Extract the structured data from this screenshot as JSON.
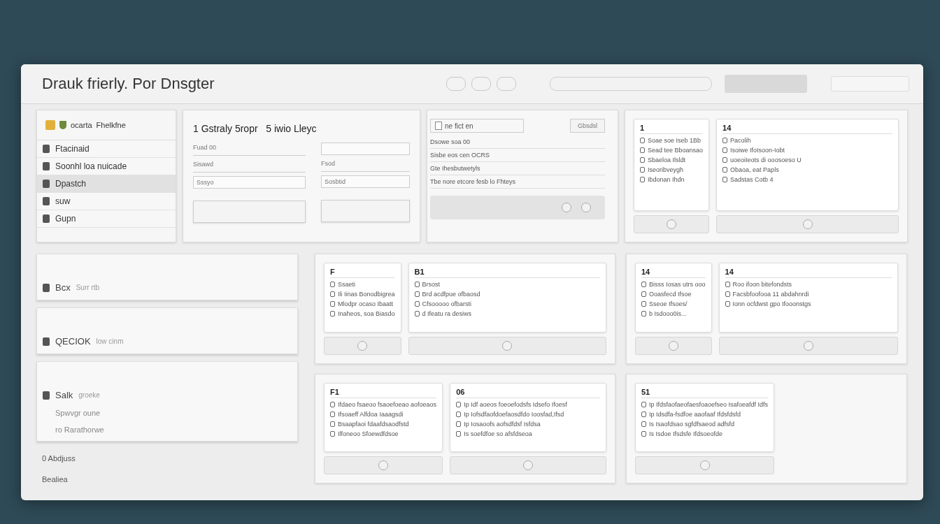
{
  "window": {
    "title": "Drauk frierly. Por Dnsgter"
  },
  "sidebar": {
    "header": [
      "ocarta",
      "Fhelkfne"
    ],
    "items": [
      {
        "label": "Ftacinaid",
        "selected": false
      },
      {
        "label": "Soonhl loa nuicade",
        "selected": false
      },
      {
        "label": "Dpastch",
        "selected": true
      },
      {
        "label": "suw",
        "selected": false
      },
      {
        "label": "Gupn",
        "selected": false
      }
    ]
  },
  "left_cards": [
    {
      "title": "Bcx",
      "subtitle": "Surr rtb"
    },
    {
      "title": "QECIOK",
      "subtitle": "low cinm"
    },
    {
      "title": "Salk",
      "subtitle": "groeke",
      "lines": [
        "Spwvgr oune",
        "ro Rarathorwe"
      ]
    }
  ],
  "footer_links": [
    "0 Abdjuss",
    "Bealiea"
  ],
  "form_panel": {
    "heading": "1 Gstraly 5ropr   5 iwio Lleyc",
    "columns": [
      [
        {
          "kind": "label",
          "text": "Fuad 00"
        },
        {
          "kind": "label",
          "text": "Sisawd"
        },
        {
          "kind": "input",
          "placeholder": "Sssyo"
        }
      ],
      [
        {
          "kind": "input"
        },
        {
          "kind": "label",
          "text": "Fsod"
        },
        {
          "kind": "input",
          "placeholder": "Sosbtid"
        }
      ]
    ]
  },
  "list_panel": {
    "check": {
      "label": "ne fict en",
      "checked": false
    },
    "button": "Gbsdsl",
    "rows": [
      "Dsowe soa 00",
      "Sisbe eos cen OCRS",
      "Gte Ihesbutwetyls",
      "Tbe nore etcore fesb lo Fhteys"
    ]
  },
  "panels": [
    {
      "cards": [
        {
          "heading": "1",
          "rows": [
            "Soae soe Iseb 1Bb",
            "Sead tee Bboansao",
            "Sbaeloa Ilsldt",
            "Iseoribveygh",
            "Ibdonan Ihdn"
          ]
        },
        {
          "heading": "14",
          "rows": [
            "Pacolih",
            "Isoiwe IfoIsoon-Iobt",
            "uoeoiIeots di ooosoeso U",
            "Obaoa, eat Papls",
            "Sadstas Cotb 4"
          ]
        }
      ]
    },
    {
      "cards": [
        {
          "heading": "F",
          "rows": [
            "Ssaeti",
            "Ili Iinas Bonodbigrea",
            "Mlodpr ocaso Ibaatt",
            "Inaheos, soa Biasdo"
          ]
        },
        {
          "heading": "B1",
          "rows": [
            "Brsost",
            "Brd acdfpue ofbaosd",
            "Cfsooooo ofbarsti",
            "d Ifeatu ra desiws"
          ]
        }
      ]
    },
    {
      "cards": [
        {
          "heading": "14",
          "rows": [
            "Bisss Iosas utrs ooo",
            "Ooasfecd Ifsoe",
            "Sseoe Ifsoes/",
            "b Isdooo0is..."
          ]
        },
        {
          "heading": "14",
          "rows": [
            "Roo ifoon bitefondsts",
            "Facsbfoofooa 11 abdahnrdi",
            "Ionn ocfdwst gpo Ifooonstgs"
          ]
        }
      ]
    },
    {
      "cards": [
        {
          "heading": "F1",
          "rows": [
            "Ifdaeo fsaeoo fsaoefoeao aofoeaos",
            "Ifsoaeff Alfdoa Iaaagsdi",
            "Bsaapfaoi fdaafdsaodfstd",
            "Ilfoneoo Sfoewdfdsoe"
          ]
        },
        {
          "heading": "06",
          "rows": [
            "Ip Idf aoeos foeoefodsfs Idsefo Ifoesf",
            "Ip Iofsdfaofdoefaosdfdo Ioosfad,Ifsd",
            "Ip Iosaoofs aofsdfdsf Isfdsa",
            "Is soefdfoe so afsfdseoa"
          ]
        }
      ]
    },
    {
      "cards": [
        {
          "heading": "51",
          "rows": [
            "Ip Ifdsfaofaeofaesfoaoefseo Isafoeafdf Idfs",
            "Ip Idsdfa-fsdfoe aaofaaf Ifdsfdsfd",
            "Is Isaofdsao sgfdfsaeod adfsfd",
            "Is Isdoe Ifsdsfe Ifdsoeofde"
          ]
        }
      ]
    }
  ]
}
